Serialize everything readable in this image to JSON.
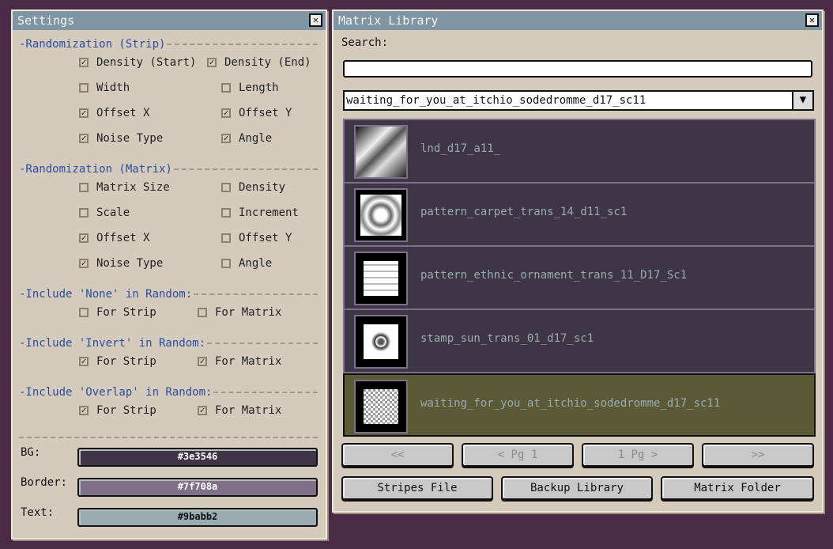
{
  "settings": {
    "title": "Settings",
    "sections": [
      {
        "title": "-Randomization (Strip)",
        "options": [
          {
            "label": "Density (Start)",
            "checked": true
          },
          {
            "label": "Density (End)",
            "checked": true
          },
          {
            "label": "Width",
            "checked": false
          },
          {
            "label": "Length",
            "checked": false
          },
          {
            "label": "Offset X",
            "checked": true
          },
          {
            "label": "Offset Y",
            "checked": true
          },
          {
            "label": "Noise Type",
            "checked": true
          },
          {
            "label": "Angle",
            "checked": true
          }
        ]
      },
      {
        "title": "-Randomization (Matrix)",
        "options": [
          {
            "label": "Matrix Size",
            "checked": false
          },
          {
            "label": "Density",
            "checked": false
          },
          {
            "label": "Scale",
            "checked": false
          },
          {
            "label": "Increment",
            "checked": false
          },
          {
            "label": "Offset X",
            "checked": true
          },
          {
            "label": "Offset Y",
            "checked": false
          },
          {
            "label": "Noise Type",
            "checked": true
          },
          {
            "label": "Angle",
            "checked": false
          }
        ]
      },
      {
        "title": "-Include 'None' in Random:",
        "options": [
          {
            "label": "For Strip",
            "checked": false
          },
          {
            "label": "For Matrix",
            "checked": false
          }
        ]
      },
      {
        "title": "-Include 'Invert' in Random:",
        "options": [
          {
            "label": "For Strip",
            "checked": true
          },
          {
            "label": "For Matrix",
            "checked": true
          }
        ]
      },
      {
        "title": "-Include 'Overlap' in Random:",
        "options": [
          {
            "label": "For Strip",
            "checked": true
          },
          {
            "label": "For Matrix",
            "checked": true
          }
        ]
      }
    ],
    "colors": [
      {
        "label": "BG:",
        "value": "#3e3546",
        "text_color": "#ffffff"
      },
      {
        "label": "Border:",
        "value": "#7f708a",
        "text_color": "#ffffff"
      },
      {
        "label": "Text:",
        "value": "#9babb2",
        "text_color": "#111111"
      }
    ]
  },
  "library": {
    "title": "Matrix Library",
    "search_label": "Search:",
    "search_value": "",
    "dropdown_value": "waiting_for_you_at_itchio_sodedromme_d17_sc11",
    "items": [
      {
        "name": "lnd_d17_a11_",
        "selected": false
      },
      {
        "name": "pattern_carpet_trans_14_d11_sc1",
        "selected": false
      },
      {
        "name": "pattern_ethnic_ornament_trans_11_D17_Sc1",
        "selected": false
      },
      {
        "name": "stamp_sun_trans_01_d17_sc1",
        "selected": false
      },
      {
        "name": "waiting_for_you_at_itchio_sodedromme_d17_sc11",
        "selected": true
      }
    ],
    "pager": [
      "<<",
      "< Pg 1",
      "1 Pg >",
      ">>"
    ],
    "actions": [
      "Stripes File",
      "Backup Library",
      "Matrix Folder"
    ]
  }
}
